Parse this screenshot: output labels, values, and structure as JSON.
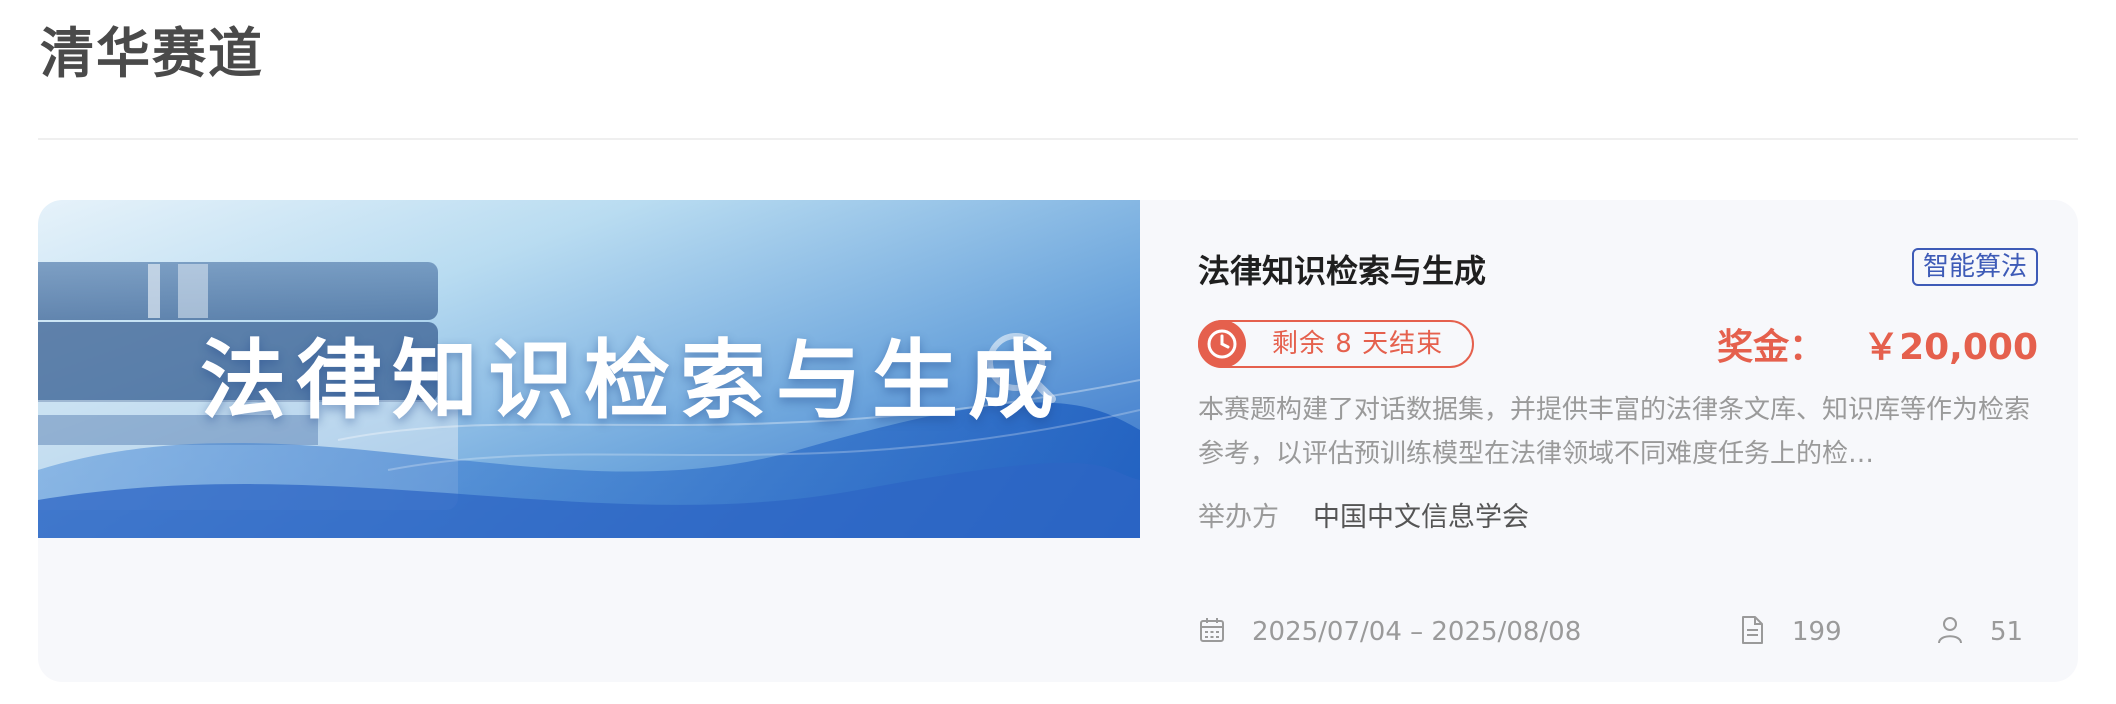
{
  "section": {
    "title": "清华赛道"
  },
  "card": {
    "banner_text": "法律知识检索与生成",
    "title": "法律知识检索与生成",
    "tag": "智能算法",
    "deadline": "剩余 8 天结束",
    "prize_label": "奖金：",
    "prize_value": "￥20,000",
    "description": "本赛题构建了对话数据集，并提供丰富的法律条文库、知识库等作为检索参考，以评估预训练模型在法律领域不同难度任务上的检…",
    "organizer_label": "举办方",
    "organizer_value": "中国中文信息学会",
    "date_range": "2025/07/04 – 2025/08/08",
    "doc_count": "199",
    "participant_count": "51"
  },
  "colors": {
    "accent_red": "#e5604d",
    "tag_blue": "#3e5bb7",
    "card_bg": "#f7f8fb"
  },
  "icons": [
    "clock-icon",
    "calendar-icon",
    "document-icon",
    "user-icon",
    "magnifier-icon"
  ]
}
